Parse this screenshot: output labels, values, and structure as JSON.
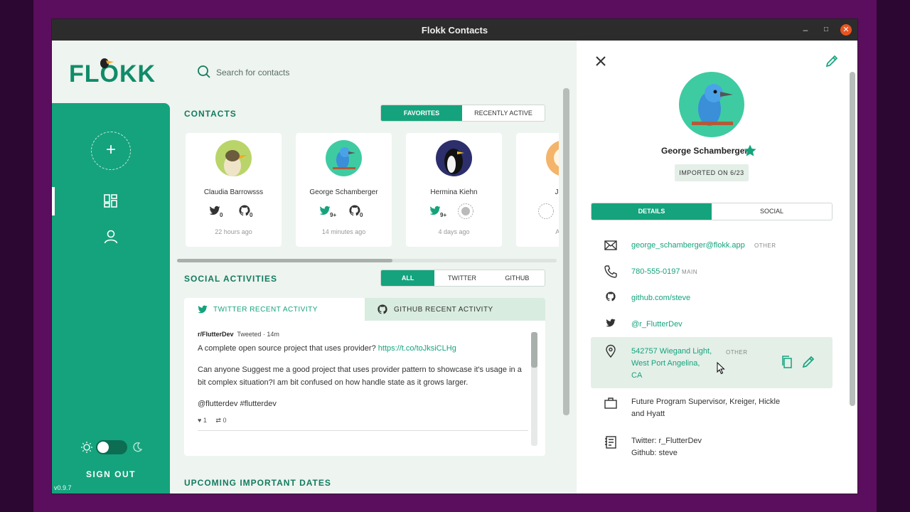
{
  "window": {
    "title": "Flokk Contacts"
  },
  "app": {
    "logo": "FLOKK",
    "version": "v0.9.7",
    "sign_out": "SIGN OUT"
  },
  "search": {
    "placeholder": "Search for contacts"
  },
  "contacts": {
    "title": "CONTACTS",
    "filters": [
      "FAVORITES",
      "RECENTLY ACTIVE"
    ],
    "active_filter": "FAVORITES",
    "cards": [
      {
        "name": "Claudia Barrowsss",
        "twitter": "0",
        "github": "0",
        "time": "22 hours ago",
        "color": "#b9d56a"
      },
      {
        "name": "George Schamberger",
        "twitter": "9+",
        "github": "0",
        "time": "14 minutes ago",
        "color": "#3fcba1"
      },
      {
        "name": "Hermina Kiehn",
        "twitter": "9+",
        "github": "",
        "time": "4 days ago",
        "color": "#2c2f6b"
      },
      {
        "name": "Jacey",
        "twitter": "",
        "github": "",
        "time": "Add S",
        "color": "#f4b46a"
      }
    ]
  },
  "social": {
    "title": "SOCIAL ACTIVITIES",
    "filters": [
      "ALL",
      "TWITTER",
      "GITHUB"
    ],
    "active_filter": "ALL",
    "tab_twitter": "TWITTER RECENT ACTIVITY",
    "tab_github": "GITHUB RECENT ACTIVITY",
    "post": {
      "author": "r/FlutterDev",
      "action": "Tweeted",
      "age": "14m",
      "line1": "A complete open source project that uses provider?",
      "link": "https://t.co/toJksiCLHg",
      "body": "Can anyone Suggest me a good project that uses provider pattern to showcase it's usage in a bit complex situation?I am bit confused on how handle state as it grows larger.",
      "tags": "@flutterdev #flutterdev",
      "likes": "1",
      "retweets": "0"
    }
  },
  "upcoming": {
    "title": "UPCOMING IMPORTANT DATES"
  },
  "detail": {
    "name": "George Schamberger",
    "badge": "IMPORTED ON 6/23",
    "tabs": [
      "DETAILS",
      "SOCIAL"
    ],
    "active_tab": "DETAILS",
    "email": "george_schamberger@flokk.app",
    "email_label": "OTHER",
    "phone": "780-555-0197",
    "phone_label": "MAIN",
    "github": "github.com/steve",
    "twitter": "@r_FlutterDev",
    "address_line1": "542757 Wiegand Light,",
    "address_line2": "West Port Angelina,",
    "address_line3": "CA",
    "address_label": "OTHER",
    "job_line1": "Future Program Supervisor, Kreiger, Hickle",
    "job_line2": "and Hyatt",
    "note_line1": "Twitter: r_FlutterDev",
    "note_line2": "Github: steve"
  },
  "colors": {
    "accent": "#15a37d",
    "sidebar": "#15a37d",
    "background": "#eef4ef"
  }
}
